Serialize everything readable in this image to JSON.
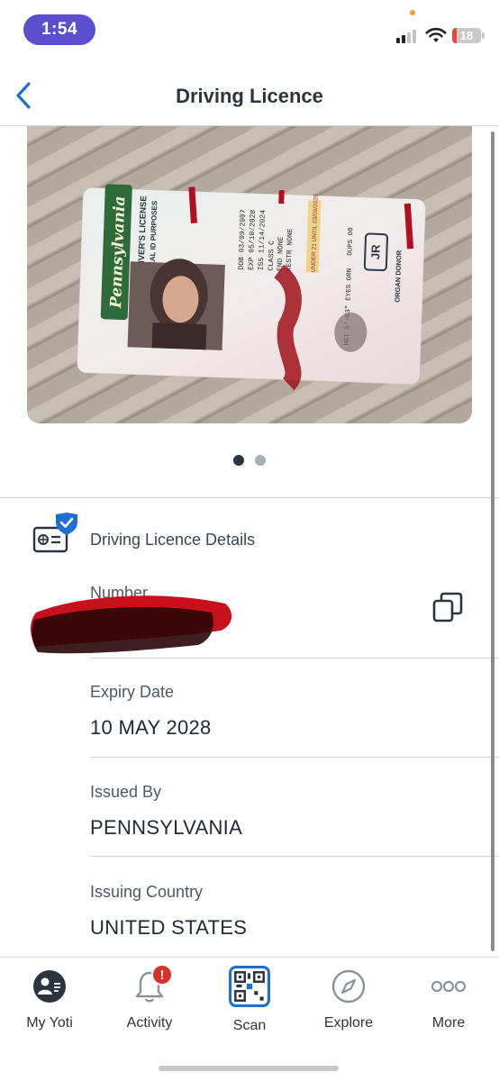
{
  "status_bar": {
    "time": "1:54",
    "battery_level": "18",
    "icons": [
      "signal-icon",
      "wifi-icon",
      "battery-icon"
    ]
  },
  "nav": {
    "title": "Driving Licence",
    "back_icon": "chevron-left-icon"
  },
  "carousel": {
    "page_count": 2,
    "active_page": 1,
    "card_photo": {
      "state": "Pennsylvania",
      "heading": "JUNIOR DRIVER'S LICENSE",
      "notice": "NOT FOR REAL ID PURPOSES",
      "dob": "DOB 03/09/2007",
      "exp": "EXP 05/10/2028",
      "iss": "ISS 11/14/2024",
      "class": "CLASS C",
      "end": "END NONE",
      "restr": "RESTR NONE",
      "under21": "UNDER 21 UNTIL 03/09/2028",
      "sex": "SEX F",
      "height": "HGT 5'-03\"",
      "eyes": "EYES GRN",
      "dups": "DUPS 00",
      "jr": "JR",
      "donor": "ORGAN DONOR"
    }
  },
  "details": {
    "header_title": "Driving Licence Details",
    "number_label": "Number",
    "expiry_label": "Expiry Date",
    "expiry_value": "10 MAY 2028",
    "issued_by_label": "Issued By",
    "issued_by_value": "PENNSYLVANIA",
    "country_label": "Issuing Country",
    "country_value": "UNITED STATES"
  },
  "tab_bar": {
    "tabs": [
      {
        "label": "My Yoti",
        "icon": "profile-icon"
      },
      {
        "label": "Activity",
        "icon": "bell-icon",
        "badge": "!"
      },
      {
        "label": "Scan",
        "icon": "qr-code-icon"
      },
      {
        "label": "Explore",
        "icon": "compass-icon"
      },
      {
        "label": "More",
        "icon": "more-dots-icon"
      }
    ]
  },
  "colors": {
    "accent": "#1f6fd0",
    "time_pill": "#5a4fcf",
    "badge": "#d9302b",
    "text_dark": "#2b3540",
    "divider": "#cfd2d6"
  }
}
